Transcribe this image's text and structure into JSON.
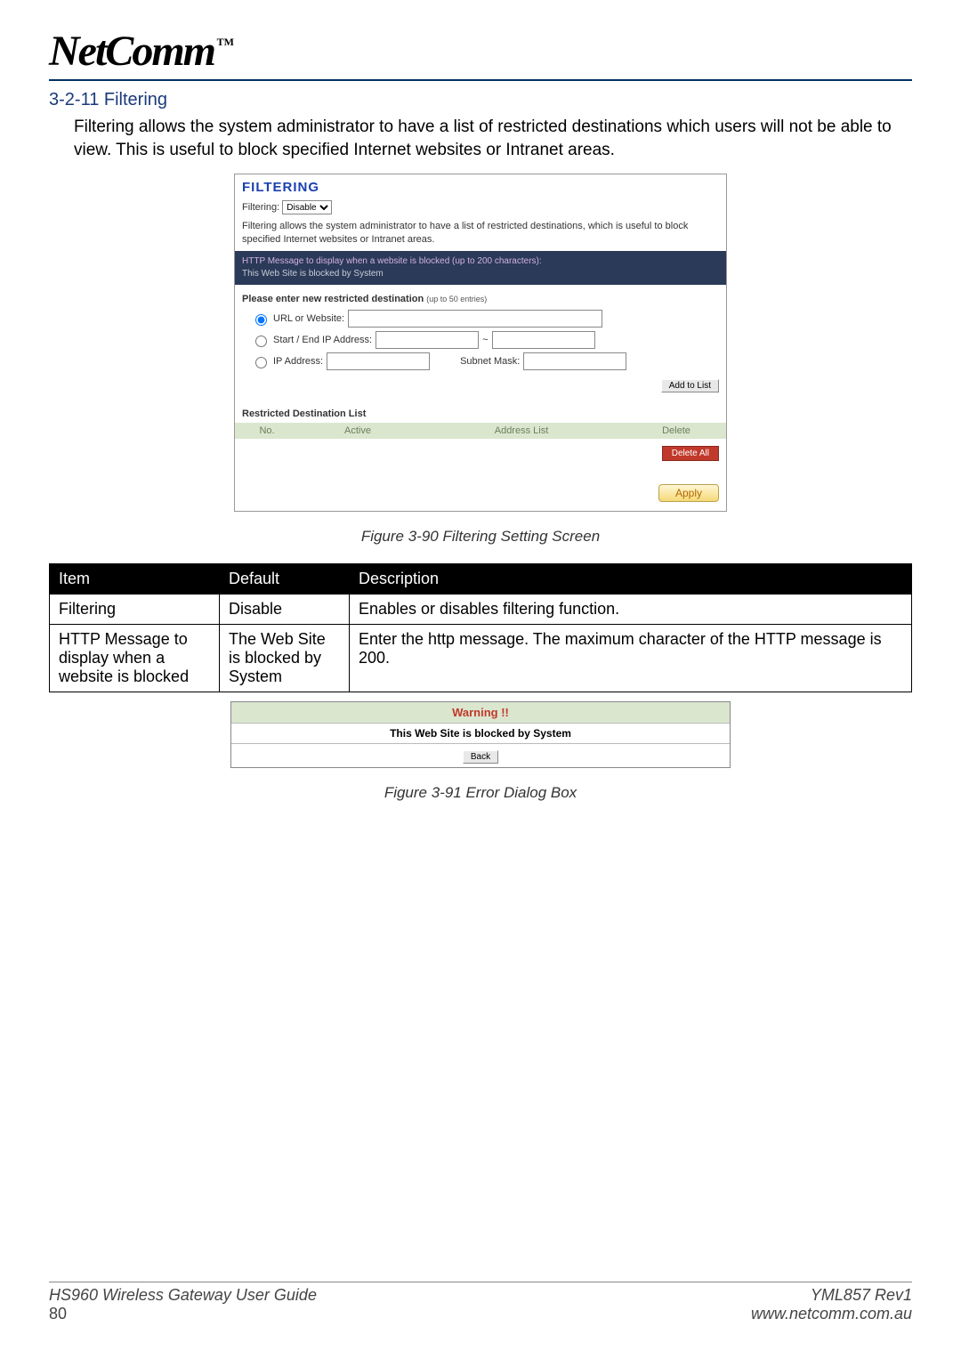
{
  "logo": {
    "name": "NetComm",
    "tm": "TM"
  },
  "section": {
    "number": "3-2-11",
    "title": "Filtering"
  },
  "intro": "Filtering allows the system administrator to have a list of restricted destinations which users will not be able to view. This is useful to block specified Internet websites or Intranet areas.",
  "shot1": {
    "heading": "FILTERING",
    "label_filtering": "Filtering:",
    "select_value": "Disable",
    "desc": "Filtering allows the system administrator to have a list of restricted destinations, which is useful to block specified Internet websites or Intranet areas.",
    "dark1": "HTTP Message to display when a website is blocked (up to 200 characters):",
    "dark2": "This Web Site is blocked by System",
    "enter_label": "Please enter new restricted destination",
    "enter_hint": "(up to 50 entries)",
    "opt_url": "URL or Website:",
    "opt_range": "Start / End IP Address:",
    "range_sep": "~",
    "opt_ip": "IP Address:",
    "subnet_label": "Subnet Mask:",
    "add_btn": "Add to List",
    "list_title": "Restricted Destination List",
    "col_no": "No.",
    "col_active": "Active",
    "col_addr": "Address List",
    "col_del": "Delete",
    "delete_all": "Delete All",
    "apply": "Apply"
  },
  "caption1": "Figure 3-90 Filtering Setting Screen",
  "desc_table": {
    "h_item": "Item",
    "h_default": "Default",
    "h_desc": "Description",
    "rows": [
      {
        "item": "Filtering",
        "def": "Disable",
        "desc": "Enables or disables filtering function."
      },
      {
        "item": "HTTP Message to display when a website is blocked",
        "def": "The Web Site is blocked by System",
        "desc": "Enter the http message. The maximum character of the HTTP message is 200."
      }
    ]
  },
  "dialog": {
    "warn": "Warning !!",
    "msg": "This Web Site is blocked by System",
    "back": "Back"
  },
  "caption2": "Figure 3-91 Error Dialog Box",
  "footer": {
    "guide": "HS960 Wireless Gateway User Guide",
    "rev": "YML857 Rev1",
    "page": "80",
    "url": "www.netcomm.com.au"
  }
}
